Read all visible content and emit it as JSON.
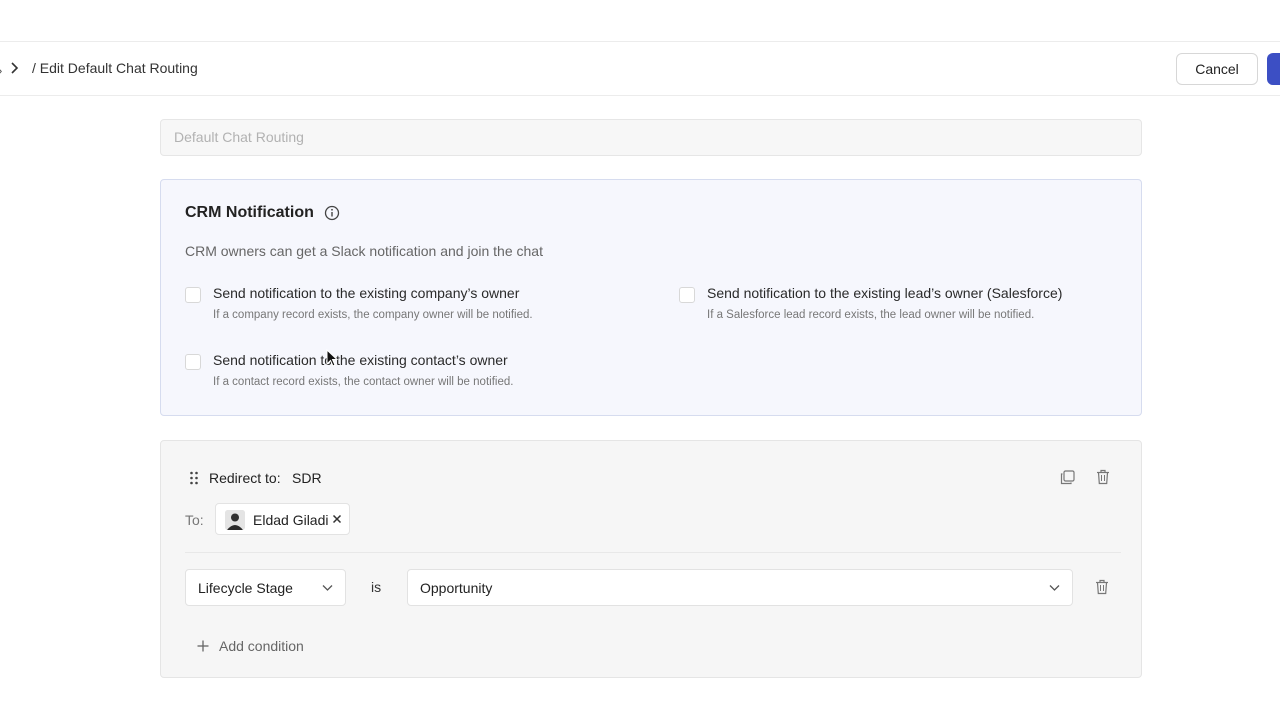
{
  "header": {
    "breadcrumb_current": "/ Edit Default Chat Routing",
    "cancel_label": "Cancel"
  },
  "name_field": {
    "value": "Default Chat Routing"
  },
  "crm_notification": {
    "title": "CRM Notification",
    "description": "CRM owners can get a Slack notification and join the chat",
    "options": [
      {
        "label": "Send notification to the existing company’s owner",
        "sub": "If a company record exists, the company owner will be notified.",
        "checked": false
      },
      {
        "label": "Send notification to the existing lead’s owner (Salesforce)",
        "sub": "If a Salesforce lead record exists, the lead owner will be notified.",
        "checked": false
      },
      {
        "label": "Send notification to the existing contact’s owner",
        "sub": "If a contact record exists, the contact owner will be notified.",
        "checked": false
      }
    ]
  },
  "rule": {
    "redirect_label": "Redirect to:",
    "redirect_value": "SDR",
    "to_label": "To:",
    "recipient": "Eldad Giladi",
    "condition": {
      "field": "Lifecycle Stage",
      "operator": "is",
      "value": "Opportunity"
    },
    "add_condition_label": "Add condition"
  },
  "colors": {
    "primary": "#3c4fc4",
    "crm_card_bg": "#f6f7fd",
    "rule_card_bg": "#f6f6f6"
  }
}
